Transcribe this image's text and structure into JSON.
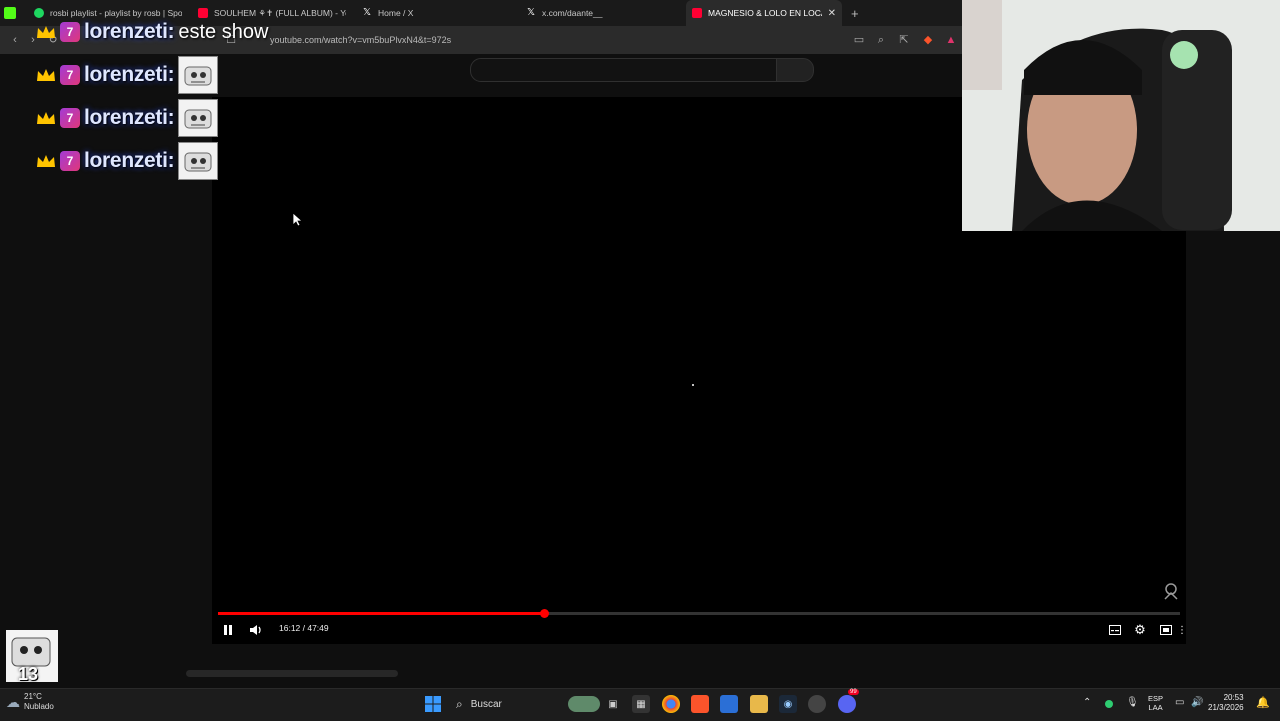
{
  "browser": {
    "tabs": [
      {
        "label": "",
        "icon": "kick-icon",
        "color": "#53fc18"
      },
      {
        "label": "rosbi playlist - playlist by rosb | Spoti",
        "icon": "spotify-icon",
        "color": "#1ed760"
      },
      {
        "label": "SOULHEM ⚘✝ (FULL ALBUM) - YouT",
        "icon": "youtube-icon",
        "color": "#ff0033"
      },
      {
        "label": "Home / X",
        "icon": "x-icon",
        "color": "#ffffff"
      },
      {
        "label": "x.com/daante__",
        "icon": "x-icon",
        "color": "#ffffff"
      },
      {
        "label": "MAGNESIO & LOLO EN LOCAL S",
        "icon": "youtube-icon",
        "color": "#ff0033"
      }
    ],
    "new_tab_label": "+",
    "url": "youtube.com/watch?v=vm5buPlvxN4&t=972s"
  },
  "player": {
    "time_current": "16:12",
    "time_total": "47:49",
    "time_display": "16:12 / 47:49",
    "progress_fraction": 0.3388,
    "accent_color": "#ff0000"
  },
  "chat": {
    "messages": [
      {
        "username": "lorenzeti:",
        "text": "este show"
      },
      {
        "username": "lorenzeti:",
        "text": ""
      },
      {
        "username": "lorenzeti:",
        "text": ""
      },
      {
        "username": "lorenzeti:",
        "text": ""
      }
    ],
    "badge_label": "7"
  },
  "corner_emote": {
    "label": "13"
  },
  "taskbar": {
    "weather_temp": "21°C",
    "weather_desc": "Nublado",
    "search_placeholder": "Buscar",
    "lang_top": "ESP",
    "lang_bottom": "LAA",
    "time": "20:53",
    "date": "21/3/2026",
    "discord_badge": "99"
  }
}
